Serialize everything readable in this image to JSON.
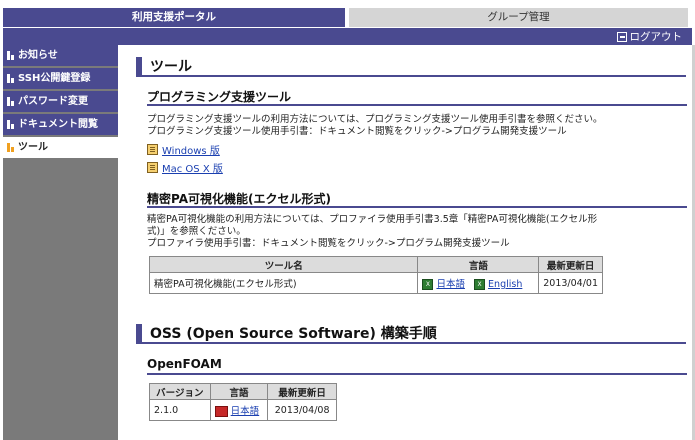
{
  "tabs": {
    "portal": "利用支援ポータル",
    "group": "グループ管理"
  },
  "header": {
    "logout": "ログアウト"
  },
  "sidebar": {
    "items": [
      {
        "label": "お知らせ"
      },
      {
        "label": "SSH公開鍵登録"
      },
      {
        "label": "パスワード変更"
      },
      {
        "label": "ドキュメント閲覧"
      },
      {
        "label": "ツール"
      }
    ]
  },
  "page": {
    "title": "ツール"
  },
  "prog": {
    "heading": "プログラミング支援ツール",
    "line1": "プログラミング支援ツールの利用方法については、プログラミング支援ツール使用手引書を参照ください。",
    "line2": "プログラミング支援ツール使用手引書：ドキュメント閲覧をクリック->プログラム開発支援ツール",
    "windows": "Windows 版",
    "mac": "Mac OS X 版"
  },
  "pa": {
    "heading": "精密PA可視化機能(エクセル形式)",
    "line1": "精密PA可視化機能の利用方法については、プロファイラ使用手引書3.5章「精密PA可視化機能(エクセル形",
    "line2": "式)」を参照ください。",
    "line3": "プロファイラ使用手引書：ドキュメント閲覧をクリック->プログラム開発支援ツール",
    "table": {
      "headers": [
        "ツール名",
        "言語",
        "最新更新日"
      ],
      "row": {
        "name": "精密PA可視化機能(エクセル形式)",
        "ja": "日本語",
        "en": "English",
        "date": "2013/04/01"
      }
    }
  },
  "oss": {
    "heading": "OSS (Open Source Software) 構築手順",
    "sub": "OpenFOAM",
    "table": {
      "headers": [
        "バージョン",
        "言語",
        "最新更新日"
      ],
      "row": {
        "version": "2.1.0",
        "ja": "日本語",
        "date": "2013/04/08"
      }
    }
  },
  "colors": {
    "accent": "#4a4a90",
    "sidebar_bg": "#7a7a7a",
    "link": "#1a3fb0"
  }
}
